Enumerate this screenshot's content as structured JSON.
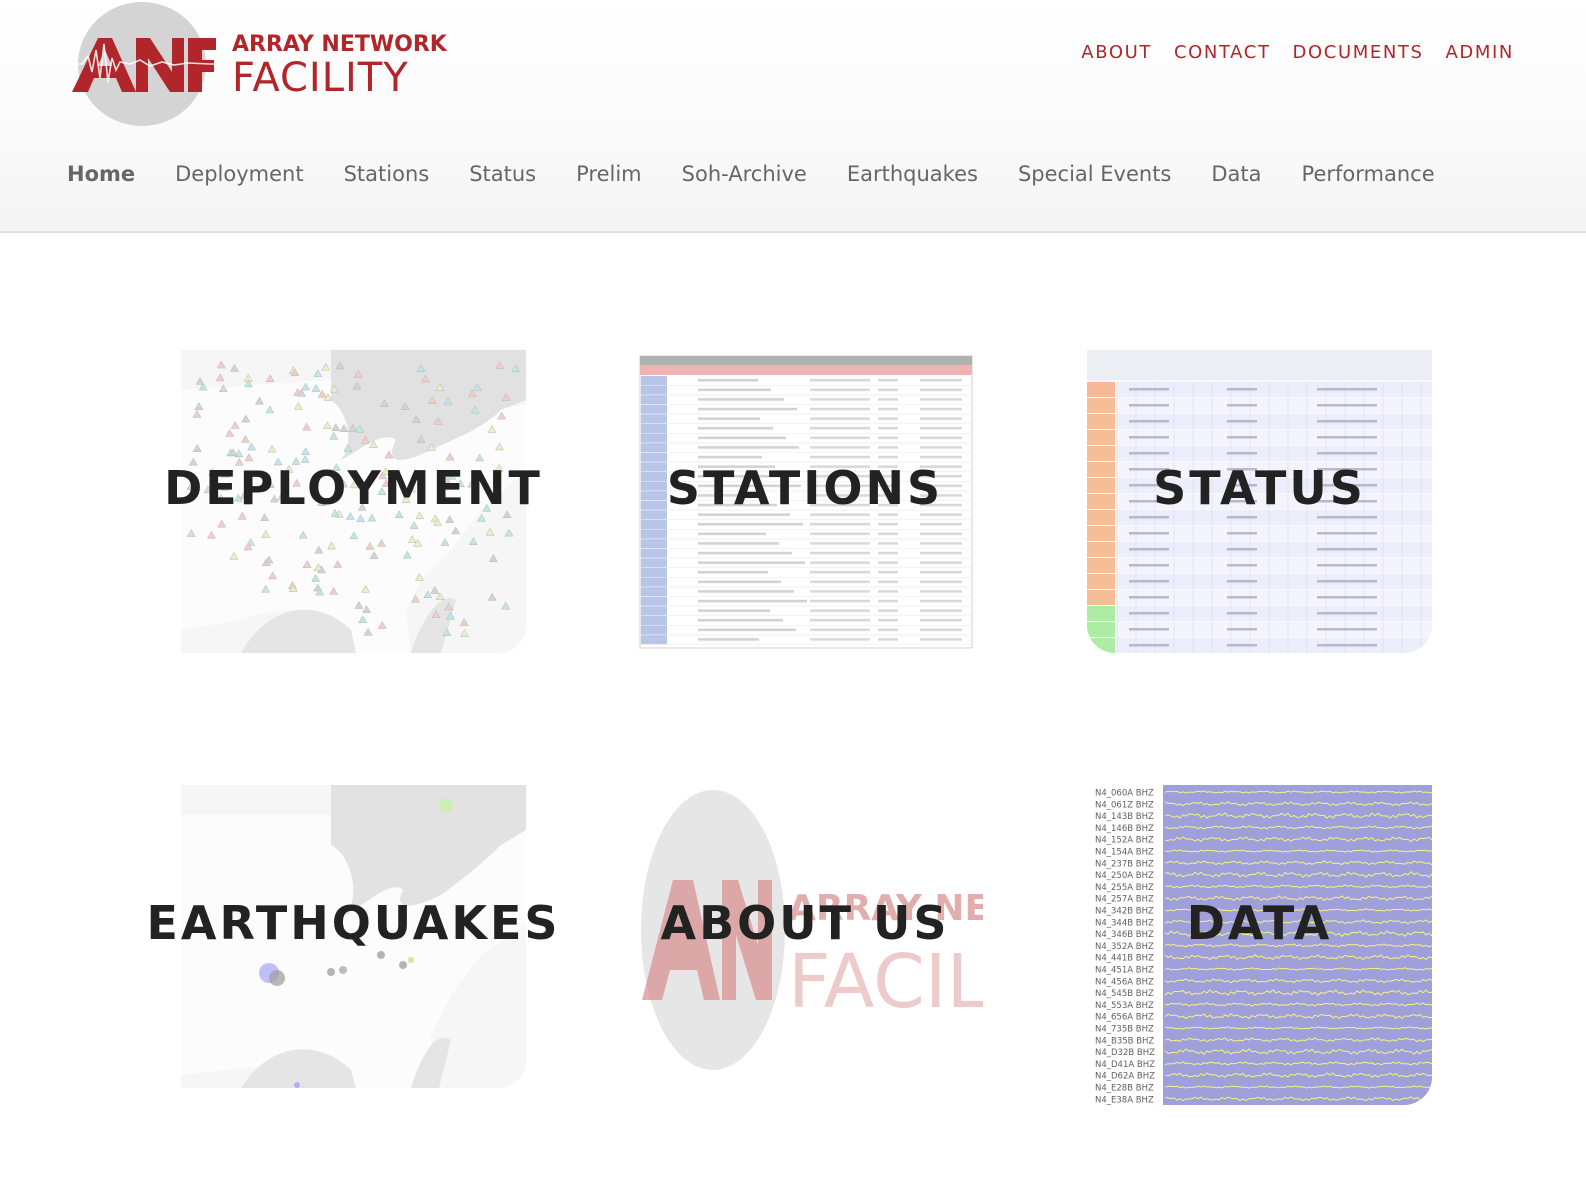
{
  "brand": {
    "logo_mark": "ANF",
    "line1": "ARRAY NETWORK",
    "line2": "FACILITY",
    "color": "#b0262b"
  },
  "top_links": [
    "ABOUT",
    "CONTACT",
    "DOCUMENTS",
    "ADMIN"
  ],
  "nav": {
    "active": "Home",
    "items": [
      "Home",
      "Deployment",
      "Stations",
      "Status",
      "Prelim",
      "Soh-Archive",
      "Earthquakes",
      "Special Events",
      "Data",
      "Performance"
    ]
  },
  "tiles": [
    {
      "label": "DEPLOYMENT",
      "image": "station-map"
    },
    {
      "label": "STATIONS",
      "image": "active-stations-table"
    },
    {
      "label": "STATUS",
      "image": "status-grid"
    },
    {
      "label": "EARTHQUAKES",
      "image": "earthquake-map"
    },
    {
      "label": "ABOUT US",
      "image": "anf-logo"
    },
    {
      "label": "DATA",
      "image": "waveform-plot"
    }
  ],
  "data_tile_channels": [
    "N4_060A BHZ",
    "N4_061Z BHZ",
    "N4_143B BHZ",
    "N4_146B BHZ",
    "N4_152A BHZ",
    "N4_154A BHZ",
    "N4_237B BHZ",
    "N4_250A BHZ",
    "N4_255A BHZ",
    "N4_257A BHZ",
    "N4_342B BHZ",
    "N4_344B BHZ",
    "N4_346B BHZ",
    "N4_352A BHZ",
    "N4_441B BHZ",
    "N4_451A BHZ",
    "N4_456A BHZ",
    "N4_545B BHZ",
    "N4_553A BHZ",
    "N4_656A BHZ",
    "N4_735B BHZ",
    "N4_B35B BHZ",
    "N4_D32B BHZ",
    "N4_D41A BHZ",
    "N4_D62A BHZ",
    "N4_E28B BHZ",
    "N4_E38A BHZ"
  ],
  "colors": {
    "accent": "#b0262b",
    "nav_text": "#666666",
    "wave_bg": "#8f8fd4",
    "wave_line": "#f3f36b"
  }
}
